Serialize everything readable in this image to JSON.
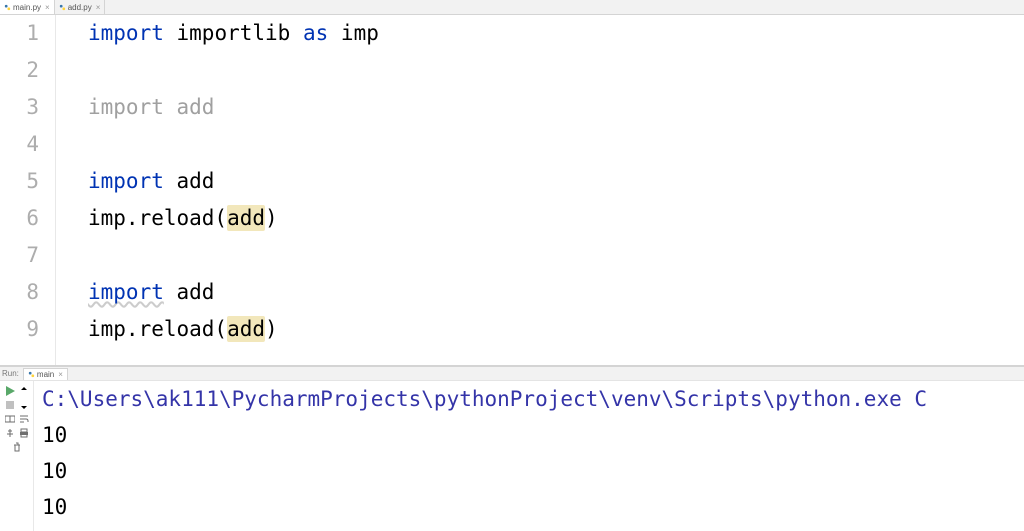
{
  "tabs": [
    {
      "label": "main.py",
      "active": true
    },
    {
      "label": "add.py",
      "active": false
    }
  ],
  "code": {
    "lines": [
      {
        "num": "1",
        "segments": [
          {
            "t": "import",
            "c": "kw"
          },
          {
            "t": " ",
            "c": "ident"
          },
          {
            "t": "importlib",
            "c": "ident"
          },
          {
            "t": " ",
            "c": "ident"
          },
          {
            "t": "as",
            "c": "kw"
          },
          {
            "t": " ",
            "c": "ident"
          },
          {
            "t": "imp",
            "c": "ident"
          }
        ],
        "fold": true
      },
      {
        "num": "2",
        "segments": []
      },
      {
        "num": "3",
        "segments": [
          {
            "t": "import",
            "c": "kw-grey"
          },
          {
            "t": " ",
            "c": "ident-grey"
          },
          {
            "t": "add",
            "c": "ident-grey"
          }
        ]
      },
      {
        "num": "4",
        "segments": []
      },
      {
        "num": "5",
        "segments": [
          {
            "t": "import",
            "c": "kw"
          },
          {
            "t": " ",
            "c": "ident"
          },
          {
            "t": "add",
            "c": "ident"
          }
        ],
        "fold": true
      },
      {
        "num": "6",
        "segments": [
          {
            "t": "imp.reload(",
            "c": "ident"
          },
          {
            "t": "add",
            "c": "hl"
          },
          {
            "t": ")",
            "c": "ident"
          }
        ]
      },
      {
        "num": "7",
        "segments": []
      },
      {
        "num": "8",
        "segments": [
          {
            "t": "import",
            "c": "kw-under"
          },
          {
            "t": " ",
            "c": "ident"
          },
          {
            "t": "add",
            "c": "ident"
          }
        ]
      },
      {
        "num": "9",
        "segments": [
          {
            "t": "imp.reload(",
            "c": "ident"
          },
          {
            "t": "add",
            "c": "hl"
          },
          {
            "t": ")",
            "c": "ident"
          }
        ]
      }
    ]
  },
  "run": {
    "label": "Run:",
    "config": "main",
    "lines": [
      {
        "segments": [
          {
            "t": "C:\\Users\\ak111\\PycharmProjects\\pythonProject\\venv\\Scripts\\python.exe",
            "c": "path"
          },
          {
            "t": " C",
            "c": "path"
          }
        ]
      },
      {
        "segments": [
          {
            "t": "10",
            "c": ""
          }
        ]
      },
      {
        "segments": [
          {
            "t": "10",
            "c": ""
          }
        ]
      },
      {
        "segments": [
          {
            "t": "10",
            "c": ""
          }
        ]
      }
    ]
  },
  "toolbar_icons": {
    "play": "play-icon",
    "arrow_up": "arrow-up-icon",
    "arrow_down": "arrow-down-icon",
    "soft_wrap": "soft-wrap-icon",
    "scroll": "scroll-to-end-icon",
    "print": "print-icon",
    "pin": "pin-icon",
    "trash": "trash-icon"
  }
}
